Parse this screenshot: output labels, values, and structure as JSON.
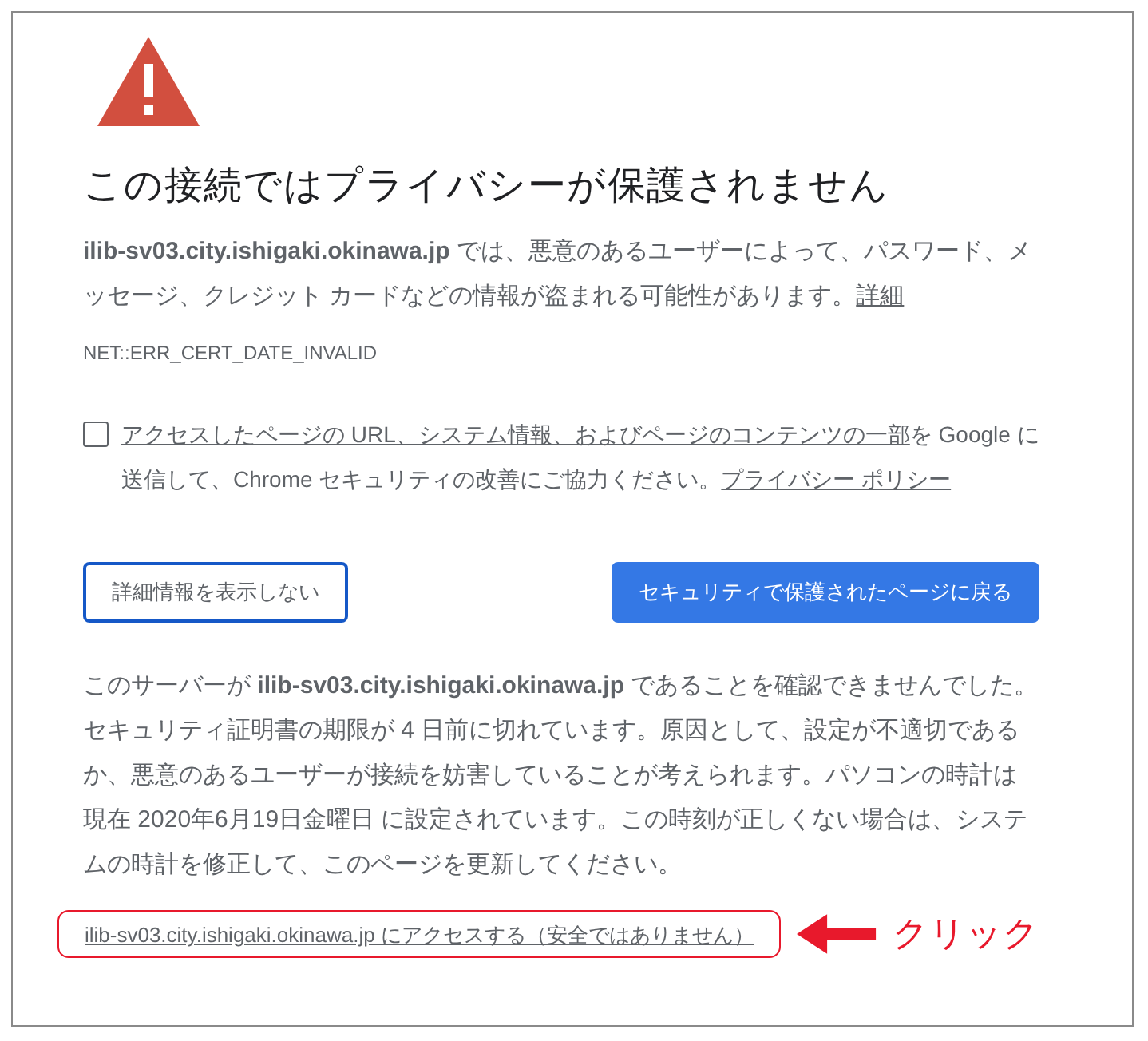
{
  "title": "この接続ではプライバシーが保護されません",
  "description": "**ilib-sv03.city.ishigaki.okinawa.jp** では、悪意のあるユーザーによって、パスワード、メッセージ、クレジット カードなどの情報が盗まれる可能性があります。",
  "details_link": "詳細",
  "error_code": "NET::ERR_CERT_DATE_INVALID",
  "report": {
    "checked": false,
    "link": "アクセスしたページの URL、システム情報、およびページのコンテンツの一部",
    "text": "を Google に送信して、Chrome セキュリティの改善にご協力ください。",
    "policy_link": "プライバシー ポリシー"
  },
  "buttons": [
    {
      "kind": "secondary",
      "label": "詳細情報を表示しない"
    },
    {
      "kind": "primary",
      "label": "セキュリティで保護されたページに戻る"
    }
  ],
  "details": "このサーバーが **ilib-sv03.city.ishigaki.okinawa.jp** であることを確認できませんでした。セキュリティ証明書の期限が 4 日前に切れています。原因として、設定が不適切であるか、悪意のあるユーザーが接続を妨害していることが考えられます。パソコンの時計は現在 2020年6月19日金曜日 に設定されています。この時刻が正しくない場合は、システムの時計を修正して、このページを更新してください。",
  "proceed_link": "ilib-sv03.city.ishigaki.okinawa.jp にアクセスする（安全ではありません）",
  "annotation": {
    "label": "クリック"
  }
}
